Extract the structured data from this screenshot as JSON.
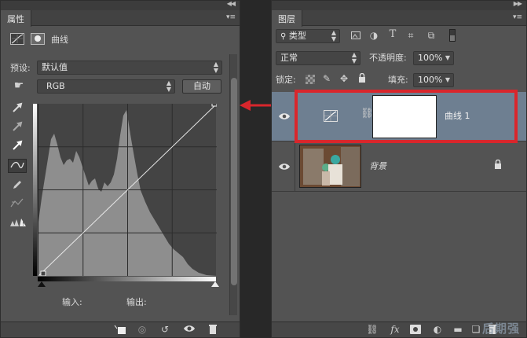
{
  "properties": {
    "tab": "属性",
    "adjustment_title": "曲线",
    "preset_label": "预设:",
    "preset_value": "默认值",
    "channel_value": "RGB",
    "auto_button": "自动",
    "input_label": "输入:",
    "output_label": "输出:"
  },
  "layers": {
    "tab": "图层",
    "filter_kind": "类型",
    "blend_mode": "正常",
    "opacity_label": "不透明度:",
    "opacity_value": "100%",
    "lock_label": "锁定:",
    "fill_label": "填充:",
    "fill_value": "100%",
    "items": [
      {
        "name": "曲线 1",
        "selected": true
      },
      {
        "name": "背景",
        "locked": true
      }
    ]
  },
  "watermark": "后期强",
  "colors": {
    "selection": "#6e7f91",
    "annotation_red": "#d9262c",
    "panel_bg": "#535353"
  }
}
